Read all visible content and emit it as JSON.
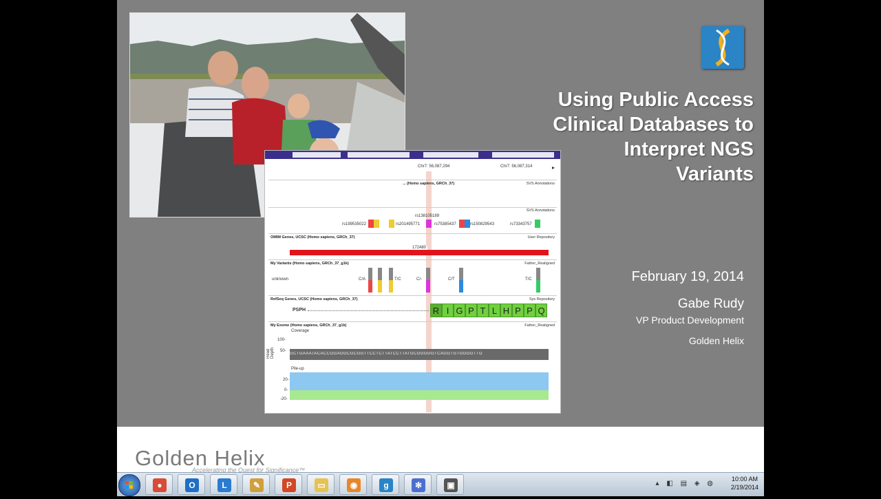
{
  "slide": {
    "title_lines": [
      "Using Public Access",
      "Clinical Databases to",
      "Interpret NGS",
      "Variants"
    ],
    "date": "February 19, 2014",
    "presenter": "Gabe Rudy",
    "role": "VP Product Development",
    "organization": "Golden Helix",
    "brand": "Golden Helix",
    "tagline": "Accelerating the Quest for Significance™"
  },
  "browser": {
    "coord_left": "Chr7: 56,087,294",
    "coord_right": "Chr7: 56,087,314",
    "tracks": [
      {
        "name": "... (Homo sapiens, GRCh_37)",
        "source": "SVS Annotations"
      },
      {
        "name": "",
        "source": "SVS Annotations"
      },
      {
        "name": "OMIM Genes, UCSC (Homo sapiens, GRCh_37)",
        "source": "User Repository"
      },
      {
        "name": "My Variants (Homo sapiens, GRCh_37_g1k)",
        "source": "Father_Realigned"
      },
      {
        "name": "RefSeq Genes, UCSC (Homo sapiens, GRCh_37)",
        "source": "Sys Repository"
      },
      {
        "name": "My Exome (Homo sapiens, GRCh_37_g1k)",
        "source": "Father_Realigned"
      }
    ],
    "rs_ids": [
      "rs138105189",
      "rs199535022",
      "rs201495771",
      "rs75385437",
      "rs150829543",
      "rs73343757"
    ],
    "omim_label": "172480",
    "variant_unknown": "unknown",
    "variant_alleles": [
      "C/A",
      "T/C",
      "C/-",
      "C/T",
      "T/C"
    ],
    "gene": "PSPH",
    "amino_acids": [
      "R",
      "I",
      "G",
      "P",
      "T",
      "L",
      "H",
      "P",
      "P",
      "Q"
    ],
    "coverage_label": "Coverage",
    "read_depth_label": "Read Depth",
    "coverage_ticks": [
      "100-",
      "50-"
    ],
    "pileup_label": "Pile-up",
    "pileup_ticks": [
      "20-",
      "0-",
      "-20-"
    ],
    "sequence": "GCTGAAATACACCGGAGGCGCGGTTCCTCTTATCCTTATGCGGGGGTCAGGTGTGGGGTTG"
  },
  "taskbar": {
    "apps": [
      {
        "name": "Chrome",
        "icon": "chrome-icon",
        "color": "#d94a38",
        "glyph": "●"
      },
      {
        "name": "Outlook",
        "icon": "outlook-icon",
        "color": "#1f6fc4",
        "glyph": "O"
      },
      {
        "name": "Lync",
        "icon": "lync-icon",
        "color": "#2b7bd0",
        "glyph": "L"
      },
      {
        "name": "Paint",
        "icon": "paint-icon",
        "color": "#d0a040",
        "glyph": "✎"
      },
      {
        "name": "PowerPoint",
        "icon": "powerpoint-icon",
        "color": "#d24726",
        "glyph": "P"
      },
      {
        "name": "Explorer",
        "icon": "folder-icon",
        "color": "#e6c253",
        "glyph": "▭"
      },
      {
        "name": "Firefox",
        "icon": "browser-icon",
        "color": "#e8862a",
        "glyph": "◉"
      },
      {
        "name": "Golden Helix",
        "icon": "golden-helix-icon",
        "color": "#2a84c6",
        "glyph": "g"
      },
      {
        "name": "Snowflake",
        "icon": "snowflake-icon",
        "color": "#4a6fd0",
        "glyph": "✻"
      },
      {
        "name": "Recorder",
        "icon": "camera-icon",
        "color": "#555",
        "glyph": "▣"
      }
    ],
    "time": "10:00 AM",
    "date": "2/19/2014"
  }
}
